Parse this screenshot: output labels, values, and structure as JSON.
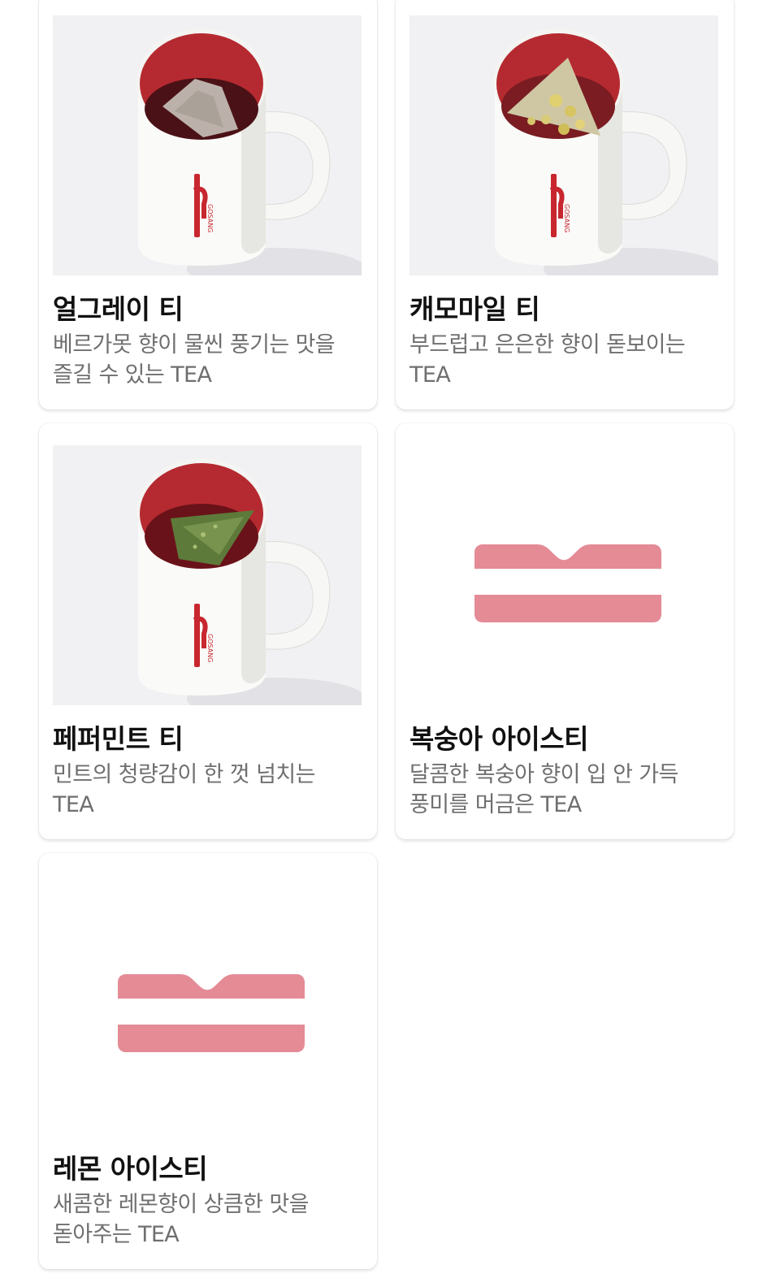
{
  "colors": {
    "brand_pink": "#e48b96",
    "mug_red": "#c8272f"
  },
  "products": [
    {
      "name": "얼그레이 티",
      "desc_lines": [
        "베르가못 향이 물씬 풍기는 맛을",
        "즐길 수 있는 TEA"
      ],
      "image": "earl-grey-mug-photo",
      "mug_text": "GOSANG"
    },
    {
      "name": "캐모마일 티",
      "desc_lines": [
        "부드럽고 은은한 향이 돋보이는",
        "TEA"
      ],
      "image": "chamomile-mug-photo",
      "mug_text": "GOSANG"
    },
    {
      "name": "페퍼민트 티",
      "desc_lines": [
        "민트의 청량감이 한 껏 넘치는",
        "TEA"
      ],
      "image": "peppermint-mug-photo",
      "mug_text": "GOSANG"
    },
    {
      "name": "복숭아 아이스티",
      "desc_lines": [
        "달콤한 복숭아 향이 입 안 가득",
        "풍미를 머금은 TEA"
      ],
      "image": "placeholder-logo"
    },
    {
      "name": "레몬 아이스티",
      "desc_lines": [
        "새콤한 레몬향이 상큼한 맛을",
        "돋아주는 TEA"
      ],
      "image": "placeholder-logo"
    }
  ]
}
